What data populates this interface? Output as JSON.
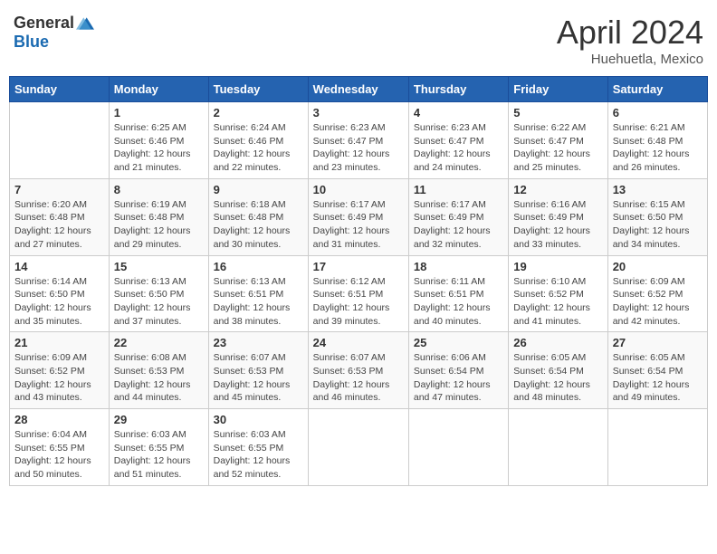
{
  "logo": {
    "general": "General",
    "blue": "Blue"
  },
  "title": {
    "month": "April 2024",
    "location": "Huehuetla, Mexico"
  },
  "headers": [
    "Sunday",
    "Monday",
    "Tuesday",
    "Wednesday",
    "Thursday",
    "Friday",
    "Saturday"
  ],
  "weeks": [
    [
      {
        "day": "",
        "info": ""
      },
      {
        "day": "1",
        "info": "Sunrise: 6:25 AM\nSunset: 6:46 PM\nDaylight: 12 hours\nand 21 minutes."
      },
      {
        "day": "2",
        "info": "Sunrise: 6:24 AM\nSunset: 6:46 PM\nDaylight: 12 hours\nand 22 minutes."
      },
      {
        "day": "3",
        "info": "Sunrise: 6:23 AM\nSunset: 6:47 PM\nDaylight: 12 hours\nand 23 minutes."
      },
      {
        "day": "4",
        "info": "Sunrise: 6:23 AM\nSunset: 6:47 PM\nDaylight: 12 hours\nand 24 minutes."
      },
      {
        "day": "5",
        "info": "Sunrise: 6:22 AM\nSunset: 6:47 PM\nDaylight: 12 hours\nand 25 minutes."
      },
      {
        "day": "6",
        "info": "Sunrise: 6:21 AM\nSunset: 6:48 PM\nDaylight: 12 hours\nand 26 minutes."
      }
    ],
    [
      {
        "day": "7",
        "info": "Sunrise: 6:20 AM\nSunset: 6:48 PM\nDaylight: 12 hours\nand 27 minutes."
      },
      {
        "day": "8",
        "info": "Sunrise: 6:19 AM\nSunset: 6:48 PM\nDaylight: 12 hours\nand 29 minutes."
      },
      {
        "day": "9",
        "info": "Sunrise: 6:18 AM\nSunset: 6:48 PM\nDaylight: 12 hours\nand 30 minutes."
      },
      {
        "day": "10",
        "info": "Sunrise: 6:17 AM\nSunset: 6:49 PM\nDaylight: 12 hours\nand 31 minutes."
      },
      {
        "day": "11",
        "info": "Sunrise: 6:17 AM\nSunset: 6:49 PM\nDaylight: 12 hours\nand 32 minutes."
      },
      {
        "day": "12",
        "info": "Sunrise: 6:16 AM\nSunset: 6:49 PM\nDaylight: 12 hours\nand 33 minutes."
      },
      {
        "day": "13",
        "info": "Sunrise: 6:15 AM\nSunset: 6:50 PM\nDaylight: 12 hours\nand 34 minutes."
      }
    ],
    [
      {
        "day": "14",
        "info": "Sunrise: 6:14 AM\nSunset: 6:50 PM\nDaylight: 12 hours\nand 35 minutes."
      },
      {
        "day": "15",
        "info": "Sunrise: 6:13 AM\nSunset: 6:50 PM\nDaylight: 12 hours\nand 37 minutes."
      },
      {
        "day": "16",
        "info": "Sunrise: 6:13 AM\nSunset: 6:51 PM\nDaylight: 12 hours\nand 38 minutes."
      },
      {
        "day": "17",
        "info": "Sunrise: 6:12 AM\nSunset: 6:51 PM\nDaylight: 12 hours\nand 39 minutes."
      },
      {
        "day": "18",
        "info": "Sunrise: 6:11 AM\nSunset: 6:51 PM\nDaylight: 12 hours\nand 40 minutes."
      },
      {
        "day": "19",
        "info": "Sunrise: 6:10 AM\nSunset: 6:52 PM\nDaylight: 12 hours\nand 41 minutes."
      },
      {
        "day": "20",
        "info": "Sunrise: 6:09 AM\nSunset: 6:52 PM\nDaylight: 12 hours\nand 42 minutes."
      }
    ],
    [
      {
        "day": "21",
        "info": "Sunrise: 6:09 AM\nSunset: 6:52 PM\nDaylight: 12 hours\nand 43 minutes."
      },
      {
        "day": "22",
        "info": "Sunrise: 6:08 AM\nSunset: 6:53 PM\nDaylight: 12 hours\nand 44 minutes."
      },
      {
        "day": "23",
        "info": "Sunrise: 6:07 AM\nSunset: 6:53 PM\nDaylight: 12 hours\nand 45 minutes."
      },
      {
        "day": "24",
        "info": "Sunrise: 6:07 AM\nSunset: 6:53 PM\nDaylight: 12 hours\nand 46 minutes."
      },
      {
        "day": "25",
        "info": "Sunrise: 6:06 AM\nSunset: 6:54 PM\nDaylight: 12 hours\nand 47 minutes."
      },
      {
        "day": "26",
        "info": "Sunrise: 6:05 AM\nSunset: 6:54 PM\nDaylight: 12 hours\nand 48 minutes."
      },
      {
        "day": "27",
        "info": "Sunrise: 6:05 AM\nSunset: 6:54 PM\nDaylight: 12 hours\nand 49 minutes."
      }
    ],
    [
      {
        "day": "28",
        "info": "Sunrise: 6:04 AM\nSunset: 6:55 PM\nDaylight: 12 hours\nand 50 minutes."
      },
      {
        "day": "29",
        "info": "Sunrise: 6:03 AM\nSunset: 6:55 PM\nDaylight: 12 hours\nand 51 minutes."
      },
      {
        "day": "30",
        "info": "Sunrise: 6:03 AM\nSunset: 6:55 PM\nDaylight: 12 hours\nand 52 minutes."
      },
      {
        "day": "",
        "info": ""
      },
      {
        "day": "",
        "info": ""
      },
      {
        "day": "",
        "info": ""
      },
      {
        "day": "",
        "info": ""
      }
    ]
  ]
}
